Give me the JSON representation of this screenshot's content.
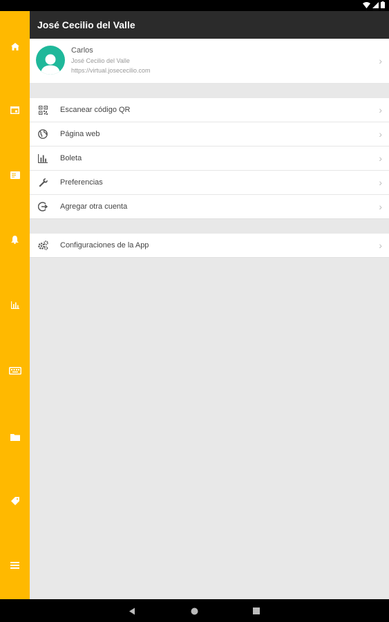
{
  "app": {
    "title": "José Cecilio del Valle"
  },
  "account": {
    "name": "Carlos",
    "institution": "José Cecilio del Valle",
    "url": "https://virtual.josececilio.com"
  },
  "menu_group_1": [
    {
      "label": "Escanear código QR",
      "icon": "qr-code-icon"
    },
    {
      "label": "Página web",
      "icon": "globe-icon"
    },
    {
      "label": "Boleta",
      "icon": "bar-chart-icon"
    },
    {
      "label": "Preferencias",
      "icon": "wrench-icon"
    },
    {
      "label": "Agregar otra cuenta",
      "icon": "add-account-icon"
    }
  ],
  "menu_group_2": [
    {
      "label": "Configuraciones de la App",
      "icon": "gears-icon"
    }
  ],
  "rail_items": [
    "home-icon",
    "calendar-icon",
    "book-icon",
    "bell-icon",
    "chart-icon",
    "keyboard-icon",
    "folder-icon",
    "tag-icon",
    "menu-icon"
  ],
  "colors": {
    "rail": "#FFB900",
    "appbar": "#2B2B2B",
    "avatar": "#1FB89A",
    "background": "#E8E8E8"
  }
}
